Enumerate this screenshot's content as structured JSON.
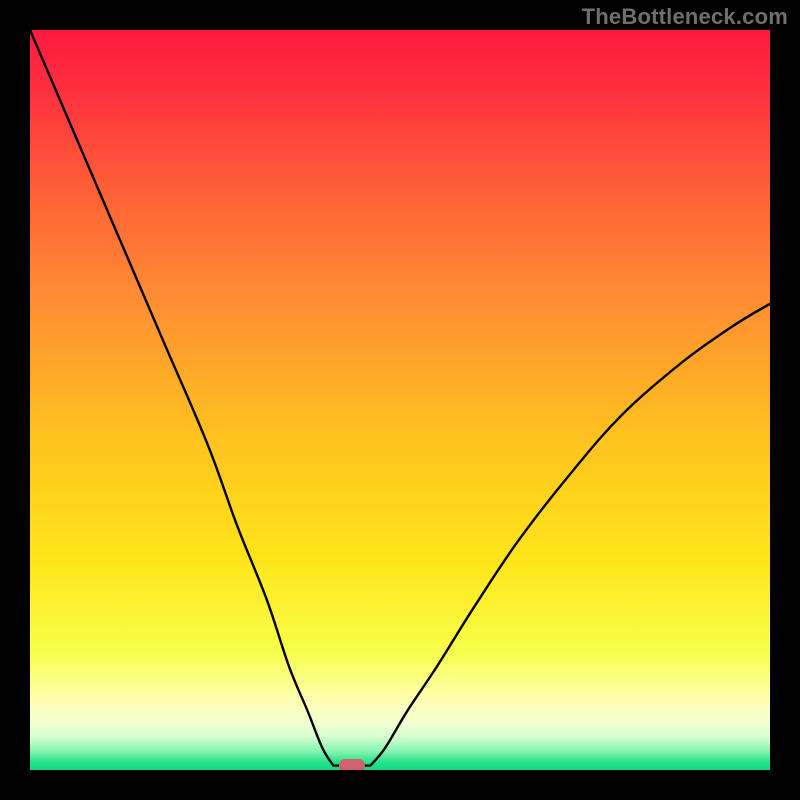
{
  "watermark": "TheBottleneck.com",
  "colors": {
    "frame": "#000000",
    "curve": "#000000",
    "marker_fill": "#d0626c",
    "gradient_stops": [
      {
        "offset": 0.0,
        "color": "#ff1a3e"
      },
      {
        "offset": 0.08,
        "color": "#ff2f3e"
      },
      {
        "offset": 0.2,
        "color": "#ff5a38"
      },
      {
        "offset": 0.35,
        "color": "#ff8a34"
      },
      {
        "offset": 0.55,
        "color": "#ffc21e"
      },
      {
        "offset": 0.72,
        "color": "#ffe61a"
      },
      {
        "offset": 0.84,
        "color": "#f8ff4a"
      },
      {
        "offset": 0.905,
        "color": "#feffb0"
      },
      {
        "offset": 0.935,
        "color": "#f4ffd0"
      },
      {
        "offset": 0.955,
        "color": "#d6ffcf"
      },
      {
        "offset": 0.975,
        "color": "#84f5b0"
      },
      {
        "offset": 0.99,
        "color": "#22e28b"
      },
      {
        "offset": 1.0,
        "color": "#16d882"
      }
    ]
  },
  "chart_data": {
    "type": "line",
    "title": "",
    "xlabel": "",
    "ylabel": "",
    "xlim": [
      0,
      100
    ],
    "ylim": [
      0,
      100
    ],
    "series": [
      {
        "name": "bottleneck-curve-left",
        "x": [
          0,
          6,
          12,
          18,
          24,
          28,
          32,
          35,
          37.5,
          39.5,
          41
        ],
        "y": [
          100,
          86,
          72,
          58,
          44,
          33,
          23,
          14,
          8,
          3,
          0.6
        ]
      },
      {
        "name": "bottleneck-curve-right",
        "x": [
          46,
          48,
          51,
          55,
          60,
          66,
          73,
          80,
          88,
          95,
          100
        ],
        "y": [
          0.6,
          3,
          8,
          14,
          22,
          31,
          40,
          48,
          55,
          60,
          63
        ]
      }
    ],
    "flat_segment": {
      "x": [
        41,
        46
      ],
      "y": 0.6
    },
    "optimum_marker": {
      "x": 43.5,
      "y": 0.6
    }
  }
}
